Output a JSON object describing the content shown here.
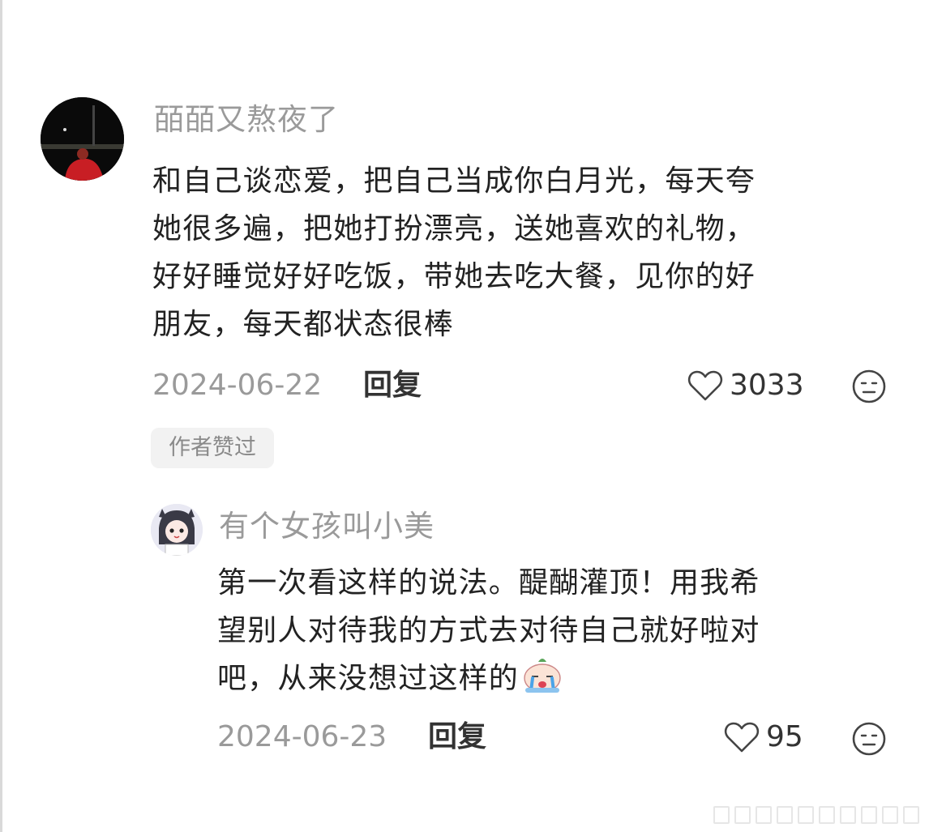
{
  "comments": [
    {
      "username": "皕皕又熬夜了",
      "avatar_icon": "night-photo-avatar",
      "text_lines": [
        "和自己谈恋爱，把自己当成你白月光，每天夸",
        "她很多遍，把她打扮漂亮，送她喜欢的礼物，",
        "好好睡觉好好吃饭，带她去吃大餐，见你的好",
        "朋友，每天都状态很棒"
      ],
      "date": "2024-06-22",
      "reply_label": "回复",
      "like_count": "3033",
      "like_icon": "heart-outline-icon",
      "dislike_icon": "meh-face-icon",
      "badge": "作者赞过"
    },
    {
      "username": "有个女孩叫小美",
      "avatar_icon": "cartoon-girl-avatar",
      "text_lines": [
        "第一次看这样的说法。醍醐灌顶！用我希",
        "望别人对待我的方式去对待自己就好啦对",
        "吧，从来没想过这样的"
      ],
      "emoji": "crying-face-emoji",
      "date": "2024-06-23",
      "reply_label": "回复",
      "like_count": "95",
      "like_icon": "heart-outline-icon",
      "dislike_icon": "meh-face-icon"
    }
  ],
  "colors": {
    "username": "#9a9a9a",
    "text": "#222222",
    "badge_bg": "#f2f2f2"
  }
}
